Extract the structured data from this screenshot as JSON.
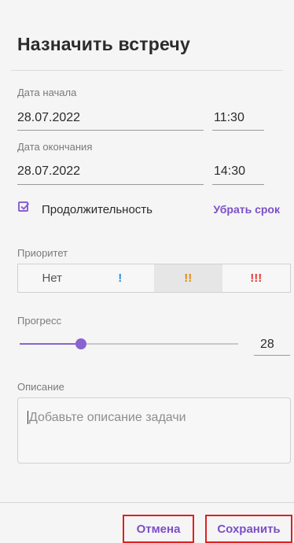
{
  "dialog": {
    "title": "Назначить встречу",
    "start": {
      "label": "Дата начала",
      "date": "28.07.2022",
      "time": "11:30"
    },
    "end": {
      "label": "Дата окончания",
      "date": "28.07.2022",
      "time": "14:30"
    },
    "duration": {
      "label": "Продолжительность",
      "checked": true,
      "remove_label": "Убрать срок"
    },
    "priority": {
      "label": "Приоритет",
      "options": [
        {
          "label": "Нет",
          "color": "#555555"
        },
        {
          "label": "!",
          "color": "#2f8fd8"
        },
        {
          "label": "!!",
          "color": "#e08a1a"
        },
        {
          "label": "!!!",
          "color": "#e53935"
        }
      ],
      "selected_index": 2
    },
    "progress": {
      "label": "Прогресс",
      "value": 28,
      "value_text": "28",
      "max": 100
    },
    "description": {
      "label": "Описание",
      "placeholder": "Добавьте описание задачи"
    },
    "footer": {
      "cancel_label": "Отмена",
      "save_label": "Сохранить"
    }
  },
  "colors": {
    "accent": "#7b4fc9",
    "highlight_border": "#e02020"
  },
  "icons": {
    "checkbox": "checkbox-checked-icon"
  }
}
